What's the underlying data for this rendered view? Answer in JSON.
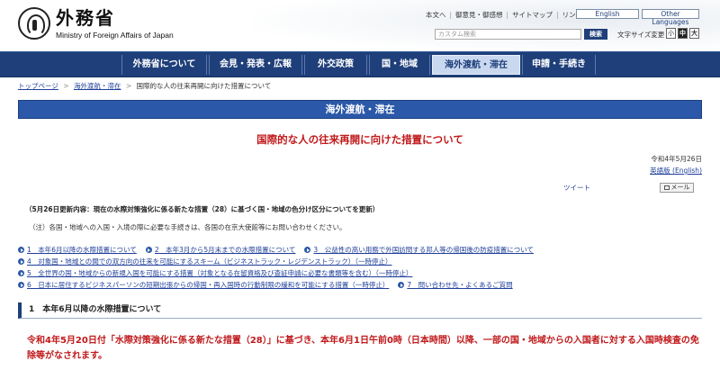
{
  "header": {
    "logo_jp": "外務省",
    "logo_en": "Ministry of Foreign Affairs of Japan",
    "util_links": [
      "本文へ",
      "御意見・御感想",
      "サイトマップ",
      "リンク集"
    ],
    "lang_english": "English",
    "lang_other": "Other Languages",
    "search_placeholder": "カスタム検索",
    "search_button": "検索",
    "font_size_label": "文字サイズ変更",
    "font_small": "小",
    "font_medium": "中",
    "font_large": "大"
  },
  "nav": {
    "items": [
      {
        "label": "外務省について"
      },
      {
        "label": "会見・発表・広報"
      },
      {
        "label": "外交政策"
      },
      {
        "label": "国・地域"
      },
      {
        "label": "海外渡航・滞在",
        "active": true
      },
      {
        "label": "申請・手続き"
      }
    ]
  },
  "breadcrumb": {
    "home": "トップページ",
    "section": "海外渡航・滞在",
    "current": "国際的な人の往来再開に向けた措置について",
    "separator": ">"
  },
  "section_banner": "海外渡航・滞在",
  "page_title": "国際的な人の往来再開に向けた措置について",
  "pub_date": "令和4年5月26日",
  "en_version": "英語版 (English)",
  "tweet": "ツイート",
  "mail": "メール",
  "update_note": "（5月26日更新内容：現在の水際対策強化に係る新たな措置（28）に基づく国・地域の色分け区分についてを更新）",
  "contact_note": "（注）各国・地域への入国・入境の際に必要な手続きは、各国の在京大使館等にお問い合わせください。",
  "toc": {
    "row1": [
      "1　本年6月以降の水際措置について",
      "2　本年3月から5月末までの水際措置について",
      "3　公益性の高い用務で外国訪問する邦人等の帰国後の防疫措置について"
    ],
    "row2": [
      "4　対象国・地域との間での双方向の往来を可能にするスキーム（ビジネストラック・レジデンストラック）（一時停止）"
    ],
    "row3": [
      "5　全世界の国・地域からの新規入国を可能にする措置（対象となる在留資格及び査証申請に必要な書類等を含む）（一時停止）"
    ],
    "row4": [
      "6　日本に居住するビジネスパーソンの短期出張からの帰国・再入国時の行動制限の緩和を可能にする措置（一時停止）",
      "7　問い合わせ先・よくあるご質問"
    ]
  },
  "section_heading": "1　本年6月以降の水際措置について",
  "body_text": "令和4年5月20日付「水際対策強化に係る新たな措置（28）」に基づき、本年6月1日午前0時（日本時間）以降、一部の国・地域からの入国者に対する入国時検査の免除等がなされます。",
  "colors": {
    "nav_bg": "#1f3f7a",
    "banner_bg": "#2b58a8",
    "title_red": "#c0191b",
    "link_blue": "#1f3f9a"
  }
}
